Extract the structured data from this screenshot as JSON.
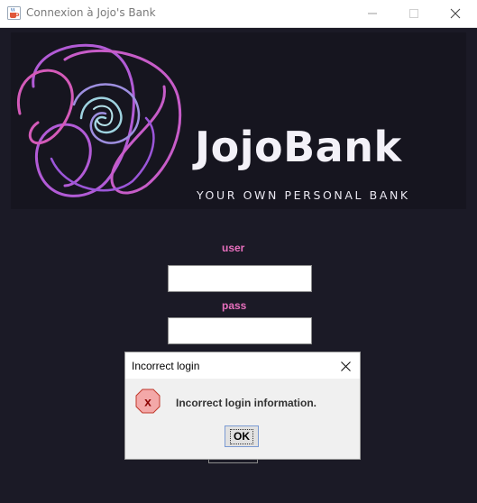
{
  "window": {
    "title": "Connexion à Jojo's Bank",
    "icons": {
      "app": "java-cup-icon",
      "minimize": "minimize-icon",
      "maximize": "maximize-icon",
      "close": "close-icon"
    }
  },
  "banner": {
    "title": "JojoBank",
    "subtitle": "YOUR OWN PERSONAL BANK",
    "logo_colors": [
      "#b25bd6",
      "#d45ab9",
      "#9e8fe0",
      "#9fd3e0"
    ]
  },
  "form": {
    "user_label": "user",
    "pass_label": "pass",
    "user_value": "",
    "pass_value": "",
    "label_color": "#e76fbd"
  },
  "dialog": {
    "title": "Incorrect login",
    "message": "Incorrect login information.",
    "ok_label": "OK",
    "icon": "error-icon",
    "icon_glyph": "x"
  },
  "colors": {
    "background": "#1b1a26",
    "banner_background": "#16151f",
    "dialog_background": "#f0f0f0"
  }
}
